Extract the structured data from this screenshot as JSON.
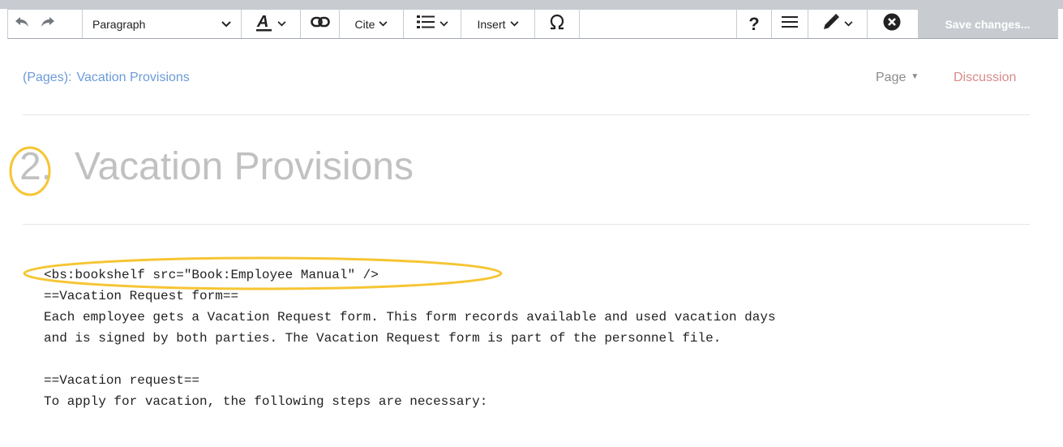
{
  "toolbar": {
    "format_label": "Paragraph",
    "cite_label": "Cite",
    "insert_label": "Insert",
    "help_label": "?",
    "save_label": "Save changes..."
  },
  "breadcrumb": {
    "namespace": "(Pages):",
    "page": "Vacation Provisions"
  },
  "tabs": {
    "page_label": "Page",
    "discussion_label": "Discussion"
  },
  "heading": {
    "number": "2.",
    "title": "Vacation Provisions"
  },
  "content": {
    "lines": [
      "<bs:bookshelf src=\"Book:Employee Manual\" />",
      "==Vacation Request form==",
      "Each employee gets a Vacation Request form. This form records available and used vacation days",
      "and is signed by both parties. The Vacation Request form is part of the personnel file.",
      "",
      "==Vacation request==",
      "To apply for vacation, the following steps are necessary:"
    ]
  },
  "colors": {
    "highlight_ring": "#f6c533",
    "link": "#6b9bd8",
    "discussion": "#d98a8a",
    "save_bg": "#c8ccd1"
  },
  "icons": [
    "undo-icon",
    "redo-icon",
    "text-style-icon",
    "link-icon",
    "list-icon",
    "special-character-icon",
    "help-icon",
    "menu-icon",
    "edit-mode-icon",
    "close-icon"
  ]
}
